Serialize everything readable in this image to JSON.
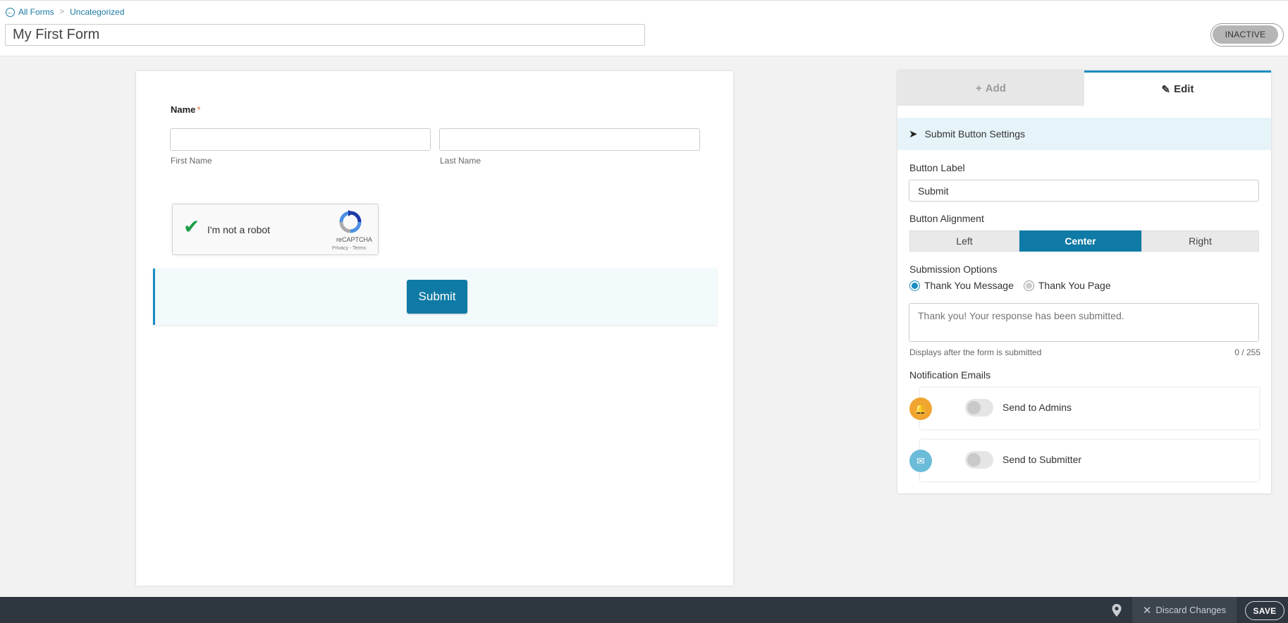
{
  "breadcrumb": {
    "back": "All Forms",
    "separator": ">",
    "current": "Uncategorized"
  },
  "form": {
    "title": "My First Form",
    "status": "INACTIVE"
  },
  "canvas": {
    "name_label": "Name",
    "required_mark": "*",
    "first_name_label": "First Name",
    "last_name_label": "Last Name",
    "recaptcha": {
      "text": "I'm not a robot",
      "brand": "reCAPTCHA",
      "terms": "Privacy - Terms"
    },
    "submit_label": "Submit"
  },
  "panel": {
    "tabs": {
      "add": "Add",
      "edit": "Edit",
      "active": "edit"
    },
    "section_title": "Submit Button Settings",
    "button_label_title": "Button Label",
    "button_label_value": "Submit",
    "alignment_title": "Button Alignment",
    "alignment_options": {
      "left": "Left",
      "center": "Center",
      "right": "Right"
    },
    "alignment_selected": "Center",
    "submission_title": "Submission Options",
    "submission_options": {
      "message": "Thank You Message",
      "page": "Thank You Page"
    },
    "submission_selected": "Thank You Message",
    "message_placeholder": "Thank you! Your response has been submitted.",
    "message_hint": "Displays after the form is submitted",
    "message_counter": "0 / 255",
    "notifications_title": "Notification Emails",
    "notifications": {
      "admins": {
        "label": "Send to Admins",
        "enabled": false,
        "badge_color": "#f0a531"
      },
      "submitter": {
        "label": "Send to Submitter",
        "enabled": false,
        "badge_color": "#6bbcd8"
      }
    }
  },
  "footer": {
    "discard": "Discard Changes",
    "save": "SAVE"
  },
  "colors": {
    "accent": "#0f7aa5",
    "tab_highlight": "#1a8cc2",
    "footer_bg": "#2e3640"
  }
}
